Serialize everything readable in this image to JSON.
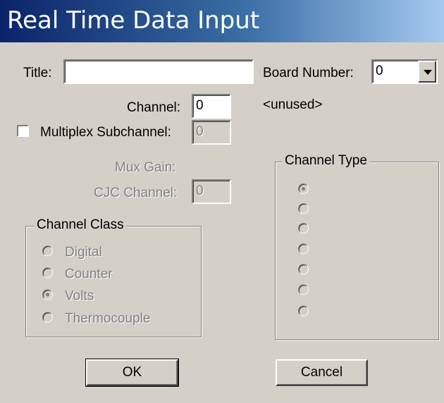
{
  "window": {
    "title": "Real Time Data Input"
  },
  "form": {
    "title_label": "Title:",
    "title_value": "",
    "board_number_label": "Board Number:",
    "board_number_value": "0",
    "channel_label": "Channel:",
    "channel_value": "0",
    "channel_status": "<unused>",
    "multiplex_label": "Multiplex Subchannel:",
    "multiplex_checked": false,
    "multiplex_value": "0",
    "mux_gain_label": "Mux Gain:",
    "cjc_channel_label": "CJC Channel:",
    "cjc_channel_value": "0"
  },
  "channel_class": {
    "label": "Channel Class",
    "options": [
      "Digital",
      "Counter",
      "Volts",
      "Thermocouple"
    ],
    "selected": "Volts"
  },
  "channel_type": {
    "label": "Channel Type",
    "option_count": 7,
    "selected_index": 0
  },
  "buttons": {
    "ok": "OK",
    "cancel": "Cancel"
  },
  "colors": {
    "titlebar_start": "#0a246a",
    "titlebar_end": "#a6caf0",
    "dialog_bg": "#d4d0c8"
  }
}
